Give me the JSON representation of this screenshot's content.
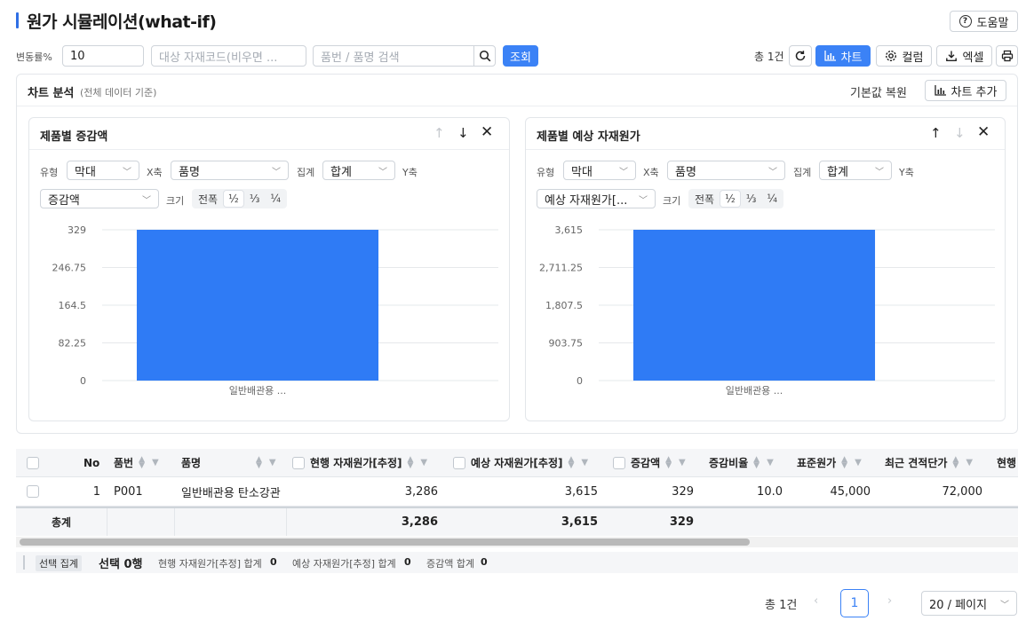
{
  "page": {
    "title": "원가 시뮬레이션(what-if)",
    "help_label": "도움말"
  },
  "toolbar": {
    "rate_label": "변동률%",
    "rate_value": "10",
    "code_placeholder": "대상 자재코드(비우면 ...",
    "search_placeholder": "품번 / 품명 검색",
    "query_label": "조회",
    "total_count": "총 1건",
    "chart_label": "차트",
    "column_label": "컬럼",
    "excel_label": "엑셀"
  },
  "analysis": {
    "title": "차트 분석",
    "subtitle": "(전체 데이터 기준)",
    "reset_label": "기본값 복원",
    "add_chart_label": "차트 추가",
    "labels": {
      "type": "유형",
      "xaxis": "X축",
      "agg": "집계",
      "yaxis": "Y축",
      "size": "크기"
    },
    "size_options": [
      "전폭",
      "½",
      "⅓",
      "¼"
    ],
    "charts": [
      {
        "title": "제품별 증감액",
        "type_value": "막대",
        "x_value": "품명",
        "agg_value": "합계",
        "y_value": "증감액"
      },
      {
        "title": "제품별 예상 자재원가",
        "type_value": "막대",
        "x_value": "품명",
        "agg_value": "합계",
        "y_value": "예상 자재원가[..."
      }
    ]
  },
  "chart_data": [
    {
      "type": "bar",
      "title": "제품별 증감액",
      "categories": [
        "일반배관용 ..."
      ],
      "values": [
        329
      ],
      "yticks": [
        "0",
        "82.25",
        "164.5",
        "246.75",
        "329"
      ],
      "ylim": [
        0,
        329
      ],
      "grid": true,
      "color": "#2f7bf5"
    },
    {
      "type": "bar",
      "title": "제품별 예상 자재원가",
      "categories": [
        "일반배관용 ..."
      ],
      "values": [
        3615
      ],
      "yticks": [
        "0",
        "903.75",
        "1,807.5",
        "2,711.25",
        "3,615"
      ],
      "ylim": [
        0,
        3615
      ],
      "grid": true,
      "color": "#2f7bf5"
    }
  ],
  "table": {
    "headers": [
      "No",
      "품번",
      "품명",
      "현행 자재원가[추정]",
      "예상 자재원가[추정]",
      "증감액",
      "증감비율",
      "표준원가",
      "최근 견적단가",
      "현행"
    ],
    "row": [
      "1",
      "P001",
      "일반배관용 탄소강관",
      "3,286",
      "3,615",
      "329",
      "10.0",
      "45,000",
      "72,000"
    ],
    "total": {
      "label": "총계",
      "current": "3,286",
      "expected": "3,615",
      "diff": "329"
    }
  },
  "selection": {
    "tag": "선택 집계",
    "count": "선택 0행",
    "items": [
      {
        "label": "현행 자재원가[추정] 합계",
        "value": "0"
      },
      {
        "label": "예상 자재원가[추정] 합계",
        "value": "0"
      },
      {
        "label": "증감액 합계",
        "value": "0"
      }
    ]
  },
  "pager": {
    "total": "총 1건",
    "current_page": "1",
    "page_size": "20 / 페이지"
  }
}
